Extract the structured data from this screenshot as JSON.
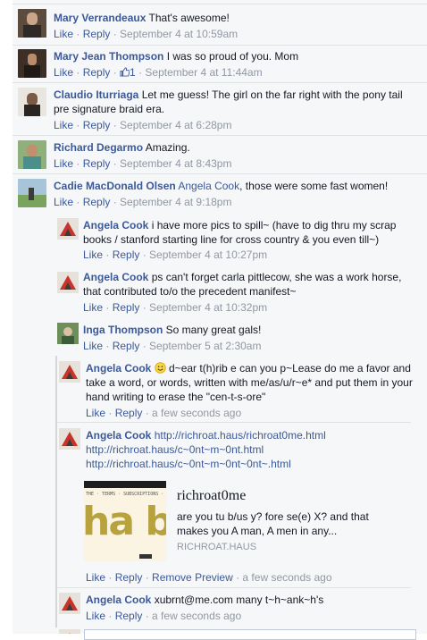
{
  "comments": [
    {
      "name": "Mary Verrandeaux",
      "text": "That's awesome!",
      "like": "Like",
      "reply": "Reply",
      "time": "September 4 at 10:59am"
    },
    {
      "name": "Mary Jean Thompson",
      "text": "I was so proud of you. Mom",
      "like": "Like",
      "reply": "Reply",
      "likes": "1",
      "time": "September 4 at 11:44am"
    },
    {
      "name": "Claudio Iturriaga",
      "text": "Let me guess! The girl on the far right with the pony tail pre signature braid era.",
      "like": "Like",
      "reply": "Reply",
      "time": "September 4 at 6:28pm"
    },
    {
      "name": "Richard Degarmo",
      "text": "Amazing.",
      "like": "Like",
      "reply": "Reply",
      "time": "September 4 at 8:43pm"
    },
    {
      "name": "Cadie MacDonald Olsen",
      "tag": "Angela Cook",
      "text": ", those were some fast women!",
      "like": "Like",
      "reply": "Reply",
      "time": "September 4 at 9:18pm"
    }
  ],
  "replies": [
    {
      "name": "Angela Cook",
      "text": "i have more pics to spill~ (have to dig thru my scrap books / stanford starting line for cross country & you even till~)",
      "like": "Like",
      "reply": "Reply",
      "time": "September 4 at 10:27pm"
    },
    {
      "name": "Angela Cook",
      "text": "ps can't forget carla pittlecow, she was a work horse, that contributed to/o the precedent manifest~",
      "like": "Like",
      "reply": "Reply",
      "time": "September 4 at 10:32pm"
    },
    {
      "name": "Inga Thompson",
      "text": "So many great gals!",
      "like": "Like",
      "reply": "Reply",
      "time": "September 5 at 2:30am"
    },
    {
      "name": "Angela Cook",
      "text": "d~ear t(h)rib e can you p~Lease do me a favor and take a word, or words, written with me/as/u/r~e* and put them in your hand writing to erase the \"cen-t-s-ore\"",
      "like": "Like",
      "reply": "Reply",
      "time": "a few seconds ago"
    },
    {
      "name": "Angela Cook",
      "link1": "http://richroat.haus/richroat0me.html",
      "link2": "http://richroat.haus/c~0nt~m~0nt.html",
      "link3": "http://richroat.haus/c~0nt~m~0nt~0nt~.html",
      "like": "Like",
      "reply": "Reply",
      "remove": "Remove Preview",
      "time": "a few seconds ago"
    },
    {
      "name": "Angela Cook",
      "text": "xubrnt@me.com many t~h~ank~h's",
      "like": "Like",
      "reply": "Reply",
      "time": "a few seconds ago"
    }
  ],
  "preview": {
    "title": "richroat0me",
    "desc": "are you tu b/us y? fore se(e) X? and that makes you A man, A men in any...",
    "domain": "RICHROAT.HAUS",
    "img_text": "ha b"
  },
  "colors": {
    "link": "#3b5998",
    "meta": "#9197a3",
    "panel": "#f6f7f9"
  },
  "icons": {
    "like": "thumbs-up-icon",
    "emoji": "smile-emoji-icon"
  }
}
